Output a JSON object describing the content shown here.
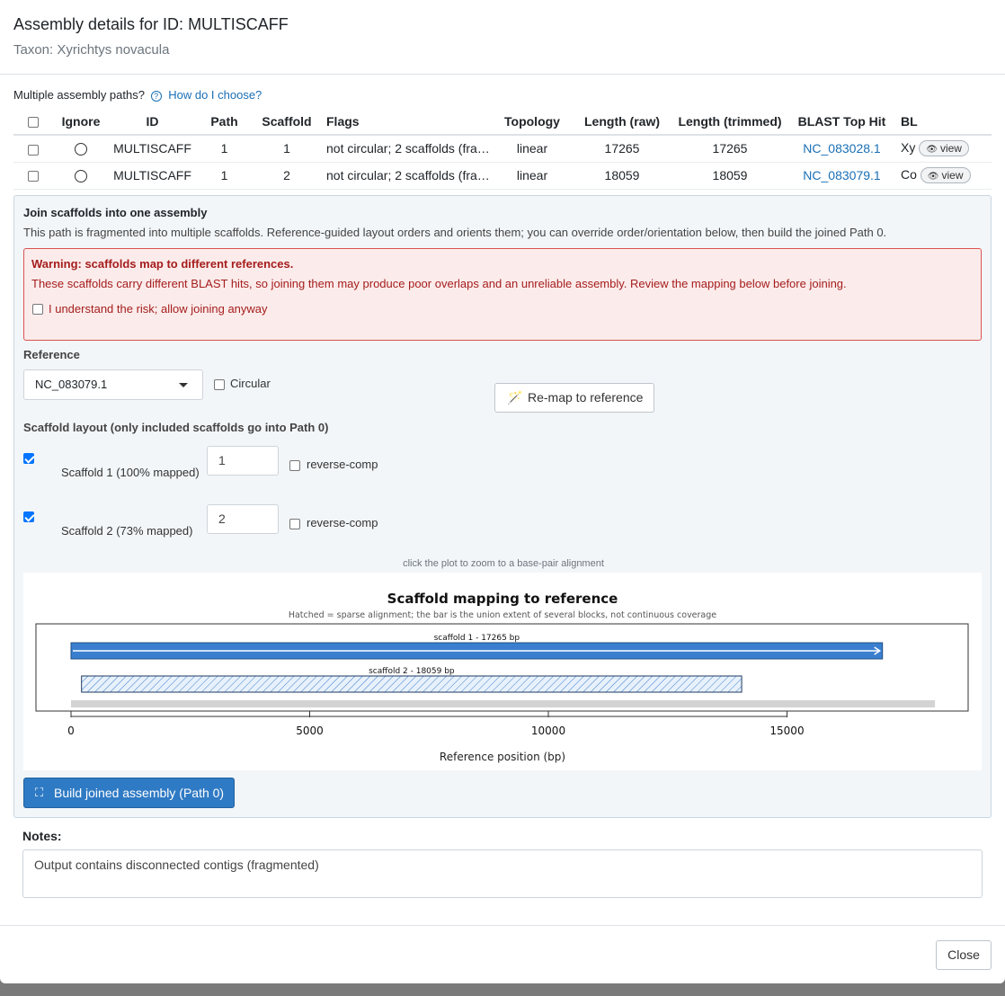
{
  "header": {
    "title": "Assembly details for ID: MULTISCAFF",
    "subtitle": "Taxon: Xyrichtys novacula"
  },
  "multi": {
    "text": "Multiple assembly paths?",
    "help_icon": "question-circle-icon",
    "help_link": "How do I choose?"
  },
  "table": {
    "headers": [
      "Ignore",
      "ID",
      "Path",
      "Scaffold",
      "Flags",
      "Topology",
      "Length (raw)",
      "Length (trimmed)",
      "BLAST Top Hit",
      "BL"
    ],
    "rows": [
      {
        "id": "MULTISCAFF",
        "path": "1",
        "scaffold": "1",
        "flags": "not circular; 2 scaffolds (fra…",
        "topology": "linear",
        "len_raw": "17265",
        "len_trim": "17265",
        "blast": "NC_083028.1",
        "bl": "Xy",
        "view": "view"
      },
      {
        "id": "MULTISCAFF",
        "path": "1",
        "scaffold": "2",
        "flags": "not circular; 2 scaffolds (fra…",
        "topology": "linear",
        "len_raw": "18059",
        "len_trim": "18059",
        "blast": "NC_083079.1",
        "bl": "Co",
        "view": "view"
      }
    ]
  },
  "join": {
    "title": "Join scaffolds into one assembly",
    "desc": "This path is fragmented into multiple scaffolds. Reference-guided layout orders and orients them; you can override order/orientation below, then build the joined Path 0.",
    "warning_title": "Warning: scaffolds map to different references.",
    "warning_text": "These scaffolds carry different BLAST hits, so joining them may produce poor overlaps and an unreliable assembly. Review the mapping below before joining.",
    "warning_check": "I understand the risk; allow joining anyway",
    "reference_label": "Reference",
    "reference_value": "NC_083079.1",
    "circular_label": "Circular",
    "remap_label": "Re-map to reference",
    "layout_title": "Scaffold layout (only included scaffolds go into Path 0)",
    "scaffolds": [
      {
        "label": "Scaffold 1 (100% mapped)",
        "order": "1",
        "rc_label": "reverse-comp"
      },
      {
        "label": "Scaffold 2 (73% mapped)",
        "order": "2",
        "rc_label": "reverse-comp"
      }
    ],
    "hint": "click the plot to zoom to a base-pair alignment",
    "build_label": "Build joined assembly (Path 0)"
  },
  "chart_data": {
    "type": "bar",
    "title": "Scaffold mapping to reference",
    "subtitle": "Hatched = sparse alignment; the bar is the union extent of several blocks, not continuous coverage",
    "xlabel": "Reference position (bp)",
    "xlim": [
      0,
      18900
    ],
    "xticks": [
      0,
      5000,
      10000,
      15000
    ],
    "xtick_labels": [
      "0",
      "5000",
      "10000",
      "15000"
    ],
    "reference_length": 18100,
    "bars": [
      {
        "label": "scaffold 1 - 17265 bp",
        "start": 0,
        "end": 17000,
        "style": "solid",
        "color": "#3a7fcf"
      },
      {
        "label": "scaffold 2 - 18059 bp",
        "start": 220,
        "end": 14050,
        "style": "hatched",
        "color": "#3a7fcf"
      }
    ]
  },
  "notes": {
    "label": "Notes:",
    "text": "Output contains disconnected contigs (fragmented)"
  },
  "footer": {
    "close_label": "Close"
  }
}
